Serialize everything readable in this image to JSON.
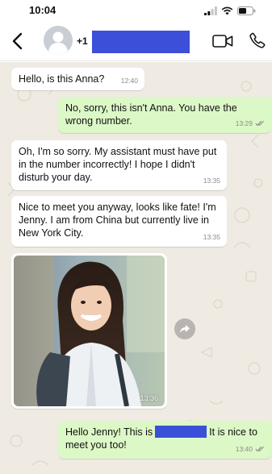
{
  "status_bar": {
    "time": "10:04"
  },
  "header": {
    "contact_prefix": "+1"
  },
  "messages": [
    {
      "direction": "in",
      "text": "Hello, is this Anna?",
      "time": "12:40"
    },
    {
      "direction": "out",
      "text": "No, sorry, this isn't Anna. You have the wrong number.",
      "time": "13:29"
    },
    {
      "direction": "in",
      "text": "Oh, I'm so sorry. My assistant must have put in the number incorrectly! I hope I didn't disturb your day.",
      "time": "13:35"
    },
    {
      "direction": "in",
      "text": "Nice to meet you anyway, looks like fate! I'm Jenny. I am from China but currently live in New York City.",
      "time": "13:35"
    },
    {
      "direction": "in",
      "type": "image",
      "time": "13:36"
    },
    {
      "direction": "out",
      "text_before": "Hello Jenny! This is",
      "text_after": "It is nice to meet you too!",
      "time": "13:40"
    }
  ],
  "colors": {
    "chat_background": "#efeae2",
    "incoming_bubble": "#ffffff",
    "outgoing_bubble": "#dcf8c6",
    "redaction": "#3b4fd9",
    "read_ticks": "#8a8a8a"
  }
}
